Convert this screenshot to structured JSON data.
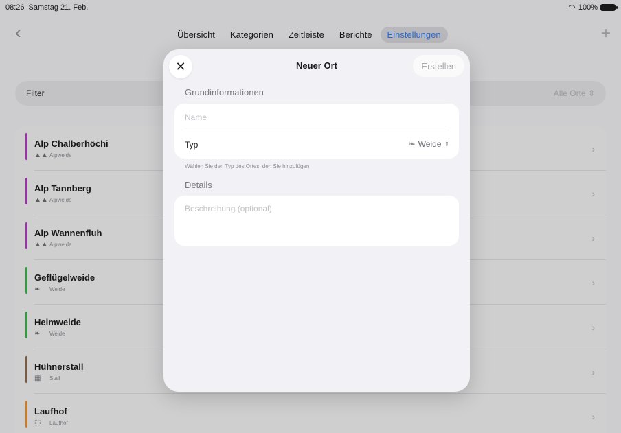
{
  "status": {
    "time": "08:26",
    "date": "Samstag 21. Feb.",
    "battery": "100%"
  },
  "nav": {
    "back_icon": "chevron-left-icon",
    "add_icon": "plus-icon",
    "tabs": [
      {
        "label": "Übersicht",
        "active": false
      },
      {
        "label": "Kategorien",
        "active": false
      },
      {
        "label": "Zeitleiste",
        "active": false
      },
      {
        "label": "Berichte",
        "active": false
      },
      {
        "label": "Einstellungen",
        "active": true
      }
    ]
  },
  "filter": {
    "label": "Filter",
    "value": "Alle Orte"
  },
  "locations": [
    {
      "name": "Alp Chalberhöchi",
      "type": "Alpweide",
      "icon": "mountain-icon",
      "color": "#b23bc2"
    },
    {
      "name": "Alp Tannberg",
      "type": "Alpweide",
      "icon": "mountain-icon",
      "color": "#b23bc2"
    },
    {
      "name": "Alp Wannenfluh",
      "type": "Alpweide",
      "icon": "mountain-icon",
      "color": "#b23bc2"
    },
    {
      "name": "Geflügelweide",
      "type": "Weide",
      "icon": "leaf-icon",
      "color": "#3ab54a"
    },
    {
      "name": "Heimweide",
      "type": "Weide",
      "icon": "leaf-icon",
      "color": "#3ab54a"
    },
    {
      "name": "Hühnerstall",
      "type": "Stall",
      "icon": "building-icon",
      "color": "#8b6a4e"
    },
    {
      "name": "Laufhof",
      "type": "Laufhof",
      "icon": "square-icon",
      "color": "#f0902c"
    }
  ],
  "modal": {
    "title": "Neuer Ort",
    "close_icon": "close-icon",
    "create_label": "Erstellen",
    "section_basic": "Grundinformationen",
    "name_placeholder": "Name",
    "type_label": "Typ",
    "type_value": "Weide",
    "type_hint": "Wählen Sie den Typ des Ortes, den Sie hinzufügen",
    "section_details": "Details",
    "description_placeholder": "Beschreibung (optional)"
  }
}
